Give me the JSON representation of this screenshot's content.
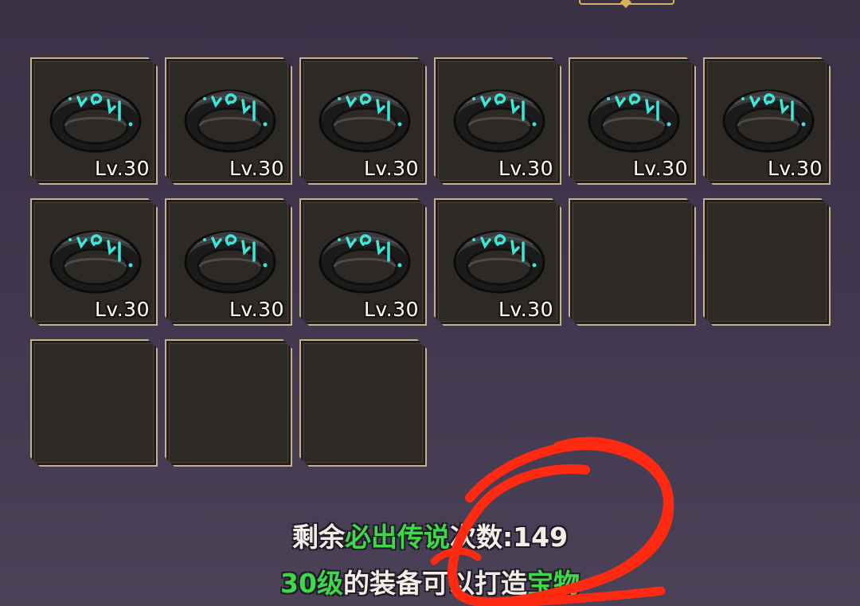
{
  "inventory": {
    "slots": [
      {
        "filled": true,
        "item": "ring-icon",
        "level": "Lv.30"
      },
      {
        "filled": true,
        "item": "ring-icon",
        "level": "Lv.30"
      },
      {
        "filled": true,
        "item": "ring-icon",
        "level": "Lv.30"
      },
      {
        "filled": true,
        "item": "ring-icon",
        "level": "Lv.30"
      },
      {
        "filled": true,
        "item": "ring-icon",
        "level": "Lv.30"
      },
      {
        "filled": true,
        "item": "ring-icon",
        "level": "Lv.30"
      },
      {
        "filled": true,
        "item": "ring-icon",
        "level": "Lv.30"
      },
      {
        "filled": true,
        "item": "ring-icon",
        "level": "Lv.30"
      },
      {
        "filled": true,
        "item": "ring-icon",
        "level": "Lv.30"
      },
      {
        "filled": true,
        "item": "ring-icon",
        "level": "Lv.30"
      },
      {
        "filled": false
      },
      {
        "filled": false
      },
      {
        "filled": false
      },
      {
        "filled": false
      },
      {
        "filled": false
      }
    ]
  },
  "info": {
    "line1": {
      "prefix": "剩余",
      "highlight": "必出传说",
      "suffix": "次数:149"
    },
    "line2": {
      "highlight1": "30级",
      "middle": "的装备可以打造",
      "highlight2": "宝物"
    }
  },
  "colors": {
    "background": "#40364d",
    "slot_fill": "#2d2925",
    "slot_border": "#c7b08f",
    "highlight_green": "#3fd84a",
    "ring_glow": "#3ee6d8",
    "annotation_red": "#ff2a12"
  }
}
